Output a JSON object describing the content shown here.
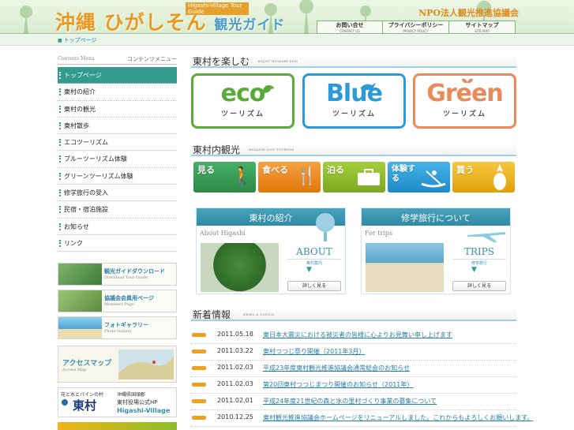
{
  "header": {
    "logo_sub": "Higashi-Village Tour Guide",
    "logo_main": "沖縄 ひがしそん",
    "logo_guide": "観光ガイド",
    "org": "NPO法人観光推進協議会",
    "topnav": [
      {
        "label": "お問い合せ",
        "sub": "CONTACT US"
      },
      {
        "label": "プライバシーポリシー",
        "sub": "PRIVACY POLICY"
      },
      {
        "label": "サイトマップ",
        "sub": "SITE MAP"
      }
    ]
  },
  "breadcrumb": {
    "label": "トップページ"
  },
  "sidebar": {
    "title_en": "Contents Menu",
    "title_jp": "コンテンツメニュー",
    "items": [
      {
        "label": "トップページ"
      },
      {
        "label": "東村の紹介"
      },
      {
        "label": "東村の観光"
      },
      {
        "label": "東村散歩"
      },
      {
        "label": "エコツーリズム"
      },
      {
        "label": "ブルーツーリズム体験"
      },
      {
        "label": "グリーンツーリズム体験"
      },
      {
        "label": "修学旅行の受入"
      },
      {
        "label": "民宿・宿泊施設"
      },
      {
        "label": "お知らせ"
      },
      {
        "label": "リンク"
      }
    ],
    "banners": [
      {
        "label": "観光ガイドダウンロード",
        "sub": "Download Tour Guide"
      },
      {
        "label": "協議会会員用ページ",
        "sub": "Members Page"
      },
      {
        "label": "フォトギャラリー",
        "sub": "Photo Gallery"
      },
      {
        "label": "アクセスマップ",
        "sub": "Access Map"
      },
      {
        "label_a": "花と水とパインの村",
        "label_b": "東村",
        "label_c": "沖縄県国頭郡",
        "label_d": "東村役場公式HP",
        "label_e": "Higashi-Village"
      }
    ]
  },
  "sections": {
    "enjoy": {
      "title": "東村を楽しむ",
      "en": "ENJOY HIGASHI-SON"
    },
    "tourism": {
      "title": "東村内観光",
      "en": "HIGASHI-SON TOURISM"
    },
    "news": {
      "title": "新着情報",
      "en": "NEWS & TOPICS"
    }
  },
  "eco_buttons": [
    {
      "big": "eco",
      "small": "ツーリズム",
      "color": "#5aaa3a"
    },
    {
      "big": "Blue",
      "small": "ツーリズム",
      "color": "#2a9bd8"
    },
    {
      "big": "Green",
      "small": "ツーリズム",
      "color": "#e88a5a"
    }
  ],
  "tour_buttons": [
    {
      "label": "見る",
      "icon": "walker-icon",
      "color": "#2f9b50"
    },
    {
      "label": "食べる",
      "icon": "cutlery-icon",
      "color": "#f08a1a"
    },
    {
      "label": "泊る",
      "icon": "suitcase-icon",
      "color": "#8cbd2a"
    },
    {
      "label": "体験する",
      "icon": "canoe-icon",
      "color": "#2a9fd8"
    },
    {
      "label": "買う",
      "icon": "pineapple-icon",
      "color": "#f0b418"
    }
  ],
  "cards": [
    {
      "title": "東村の紹介",
      "sub": "About Higashi",
      "big": "ABOUT",
      "jp": "東村案内",
      "btn": "詳しく見る"
    },
    {
      "title": "修学旅行について",
      "sub": "For trips",
      "big": "TRIPS",
      "jp": "修学旅行",
      "btn": "詳しく見る"
    }
  ],
  "news": [
    {
      "date": "2011.05.18",
      "text": "東日本大震災における被災者の皆様に心よりお見舞い申し上げます"
    },
    {
      "date": "2011.03.22",
      "text": "東村つつじ祭り開催（2011年3月）"
    },
    {
      "date": "2011.02.03",
      "text": "平成23年度東村観光推進協議会通常総会のお知らせ"
    },
    {
      "date": "2011.02.03",
      "text": "第20回東村つつじまつり開催のお知らせ（2011年）"
    },
    {
      "date": "2011.02.01",
      "text": "平成24年度21世紀の森と水の里村づくり事業の募集について"
    },
    {
      "date": "2010.12.25",
      "text": "東村観光推進協議会ホームページをリニューアルしました。これからもよろしくお願いします。"
    }
  ]
}
